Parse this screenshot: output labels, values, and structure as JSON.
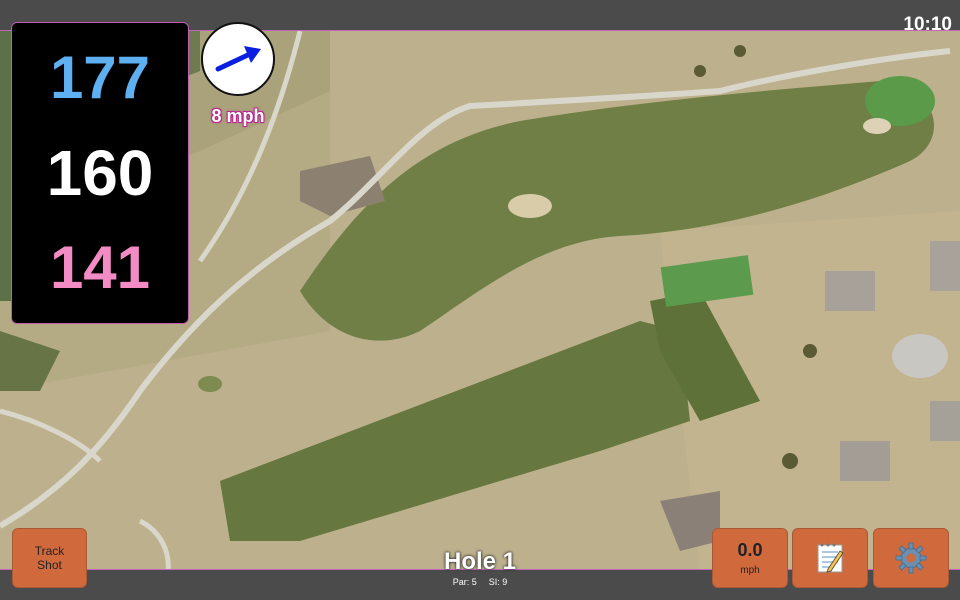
{
  "status_bar": {
    "time": "10:10"
  },
  "distances": {
    "back": "177",
    "middle": "160",
    "front": "141"
  },
  "wind": {
    "speed_label": "8 mph",
    "direction_icon": "wind-arrow-icon",
    "arrow_color": "#0a1fe0"
  },
  "hole": {
    "title": "Hole 1",
    "par_label": "Par: 5",
    "si_label": "SI: 9"
  },
  "buttons": {
    "track_shot_line1": "Track",
    "track_shot_line2": "Shot",
    "wind_value": "0.0",
    "wind_unit": "mph",
    "notes_icon": "notepad-icon",
    "settings_icon": "gear-icon"
  },
  "colors": {
    "accent_button": "#d06a3d",
    "back_distance": "#5eb0f1",
    "middle_distance": "#ffffff",
    "front_distance": "#f38bc4",
    "panel_border": "#bf5fb0"
  }
}
